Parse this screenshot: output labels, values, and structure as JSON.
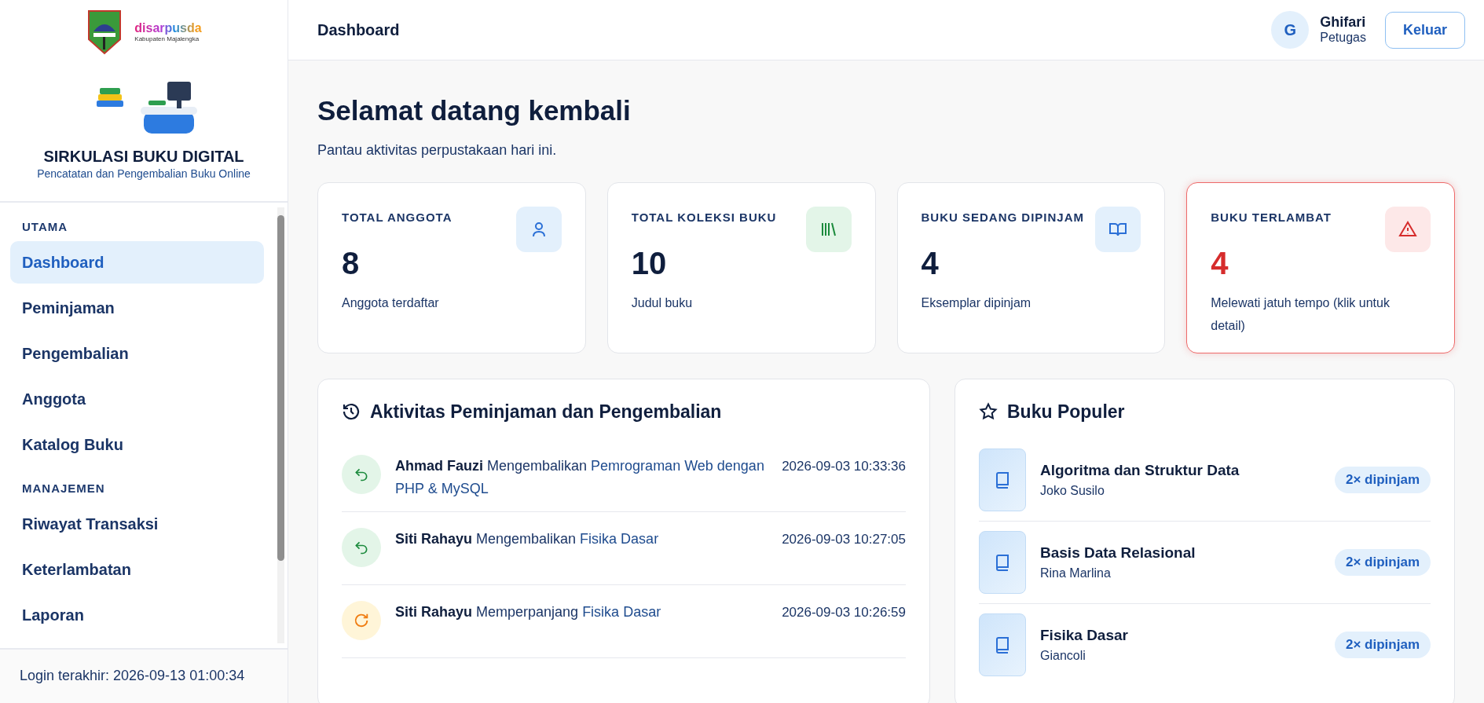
{
  "brand": {
    "name": "disarpusda",
    "region": "Kabupaten Majalengka",
    "title": "SIRKULASI BUKU DIGITAL",
    "subtitle": "Pencatatan dan Pengembalian Buku Online"
  },
  "sidebar": {
    "sections": [
      {
        "label": "UTAMA",
        "items": [
          {
            "label": "Dashboard",
            "selected": true
          },
          {
            "label": "Peminjaman",
            "selected": false
          },
          {
            "label": "Pengembalian",
            "selected": false
          },
          {
            "label": "Anggota",
            "selected": false
          },
          {
            "label": "Katalog Buku",
            "selected": false
          }
        ]
      },
      {
        "label": "MANAJEMEN",
        "items": [
          {
            "label": "Riwayat Transaksi",
            "selected": false
          },
          {
            "label": "Keterlambatan",
            "selected": false
          },
          {
            "label": "Laporan",
            "selected": false
          }
        ]
      }
    ],
    "footer": "Login terakhir: 2026-09-13 01:00:34"
  },
  "header": {
    "title": "Dashboard",
    "user": {
      "initial": "G",
      "name": "Ghifari",
      "role": "Petugas"
    },
    "logout": "Keluar"
  },
  "page": {
    "title": "Selamat datang kembali",
    "subtitle": "Pantau aktivitas perpustakaan hari ini."
  },
  "stats": [
    {
      "kind": "members",
      "label": "TOTAL ANGGOTA",
      "value": "8",
      "note": "Anggota terdaftar",
      "alert": false
    },
    {
      "kind": "books",
      "label": "TOTAL KOLEKSI BUKU",
      "value": "10",
      "note": "Judul buku",
      "alert": false
    },
    {
      "kind": "borrowed",
      "label": "BUKU SEDANG DIPINJAM",
      "value": "4",
      "note": "Eksemplar dipinjam",
      "alert": false
    },
    {
      "kind": "late",
      "label": "BUKU TERLAMBAT",
      "value": "4",
      "note": "Melewati jatuh tempo (klik untuk detail)",
      "alert": true
    }
  ],
  "activity": {
    "title": "Aktivitas Peminjaman dan Pengembalian",
    "items": [
      {
        "kind": "return",
        "name": "Ahmad Fauzi",
        "action": "Mengembalikan",
        "book": "Pemrograman Web dengan PHP & MySQL",
        "time": "2026-09-03 10:33:36"
      },
      {
        "kind": "return",
        "name": "Siti Rahayu",
        "action": "Mengembalikan",
        "book": "Fisika Dasar",
        "time": "2026-09-03 10:27:05"
      },
      {
        "kind": "extend",
        "name": "Siti Rahayu",
        "action": "Memperpanjang",
        "book": "Fisika Dasar",
        "time": "2026-09-03 10:26:59"
      }
    ]
  },
  "popular": {
    "title": "Buku Populer",
    "items": [
      {
        "title": "Algoritma dan Struktur Data",
        "author": "Joko Susilo",
        "count": "2× dipinjam"
      },
      {
        "title": "Basis Data Relasional",
        "author": "Rina Marlina",
        "count": "2× dipinjam"
      },
      {
        "title": "Fisika Dasar",
        "author": "Giancoli",
        "count": "2× dipinjam"
      }
    ]
  }
}
